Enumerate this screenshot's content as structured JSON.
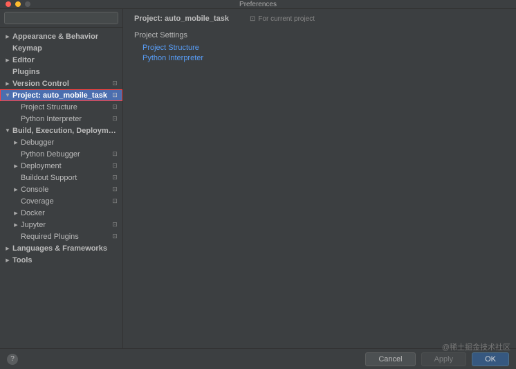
{
  "window": {
    "title": "Preferences"
  },
  "search": {
    "placeholder": ""
  },
  "sidebar": {
    "appearance": "Appearance & Behavior",
    "keymap": "Keymap",
    "editor": "Editor",
    "plugins": "Plugins",
    "version_control": "Version Control",
    "project": "Project: auto_mobile_task",
    "project_structure": "Project Structure",
    "python_interpreter": "Python Interpreter",
    "build": "Build, Execution, Deployment",
    "debugger": "Debugger",
    "python_debugger": "Python Debugger",
    "deployment": "Deployment",
    "buildout": "Buildout Support",
    "console": "Console",
    "coverage": "Coverage",
    "docker": "Docker",
    "jupyter": "Jupyter",
    "required_plugins": "Required Plugins",
    "languages": "Languages & Frameworks",
    "tools": "Tools"
  },
  "main": {
    "title": "Project: auto_mobile_task",
    "scope": "For current project",
    "section": "Project Settings",
    "link_structure": "Project Structure",
    "link_interpreter": "Python Interpreter"
  },
  "footer": {
    "cancel": "Cancel",
    "apply": "Apply",
    "ok": "OK",
    "help": "?"
  },
  "watermark": "@稀土掘金技术社区"
}
